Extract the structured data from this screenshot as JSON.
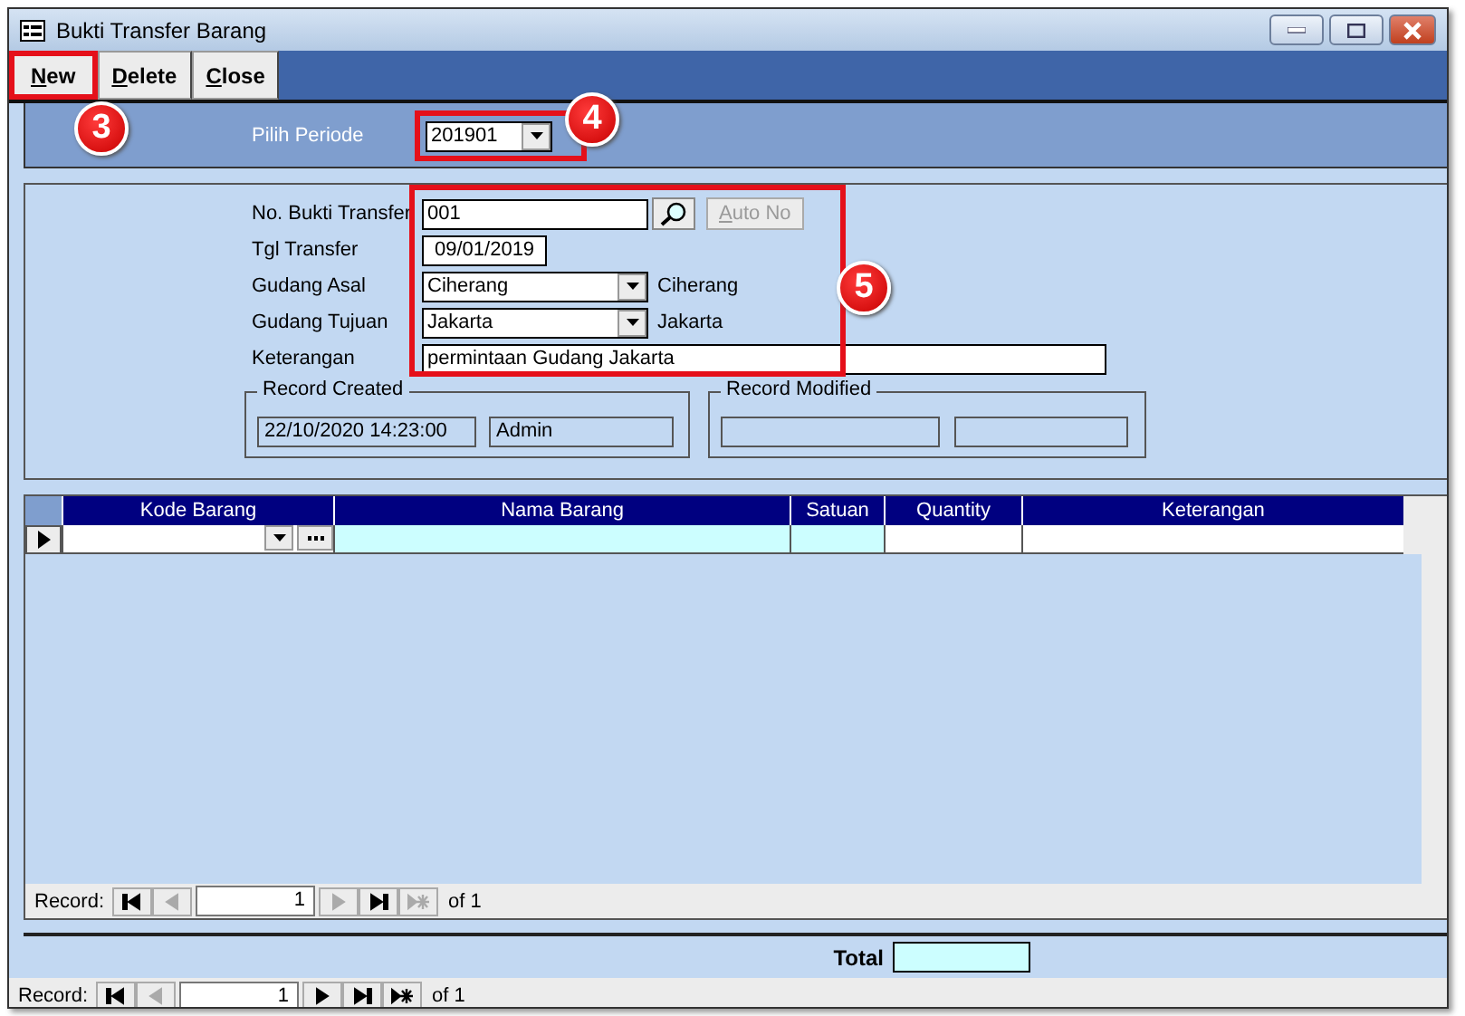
{
  "window": {
    "title": "Bukti Transfer Barang"
  },
  "toolbar": {
    "buttons": [
      {
        "label": "New",
        "highlighted": true
      },
      {
        "label": "Delete",
        "highlighted": false
      },
      {
        "label": "Close",
        "highlighted": false
      }
    ],
    "callout": "3"
  },
  "period": {
    "label": "Pilih Periode",
    "value": "201901",
    "callout": "4"
  },
  "form": {
    "callout": "5",
    "fields": [
      {
        "label": "No. Bukti Transfer",
        "kind": "lookup",
        "value": "001",
        "button": {
          "label": "Auto No",
          "disabled": true
        }
      },
      {
        "label": "Tgl Transfer",
        "kind": "date",
        "value": "09/01/2019"
      },
      {
        "label": "Gudang Asal",
        "kind": "combo",
        "value": "Ciherang",
        "caption": "Ciherang"
      },
      {
        "label": "Gudang Tujuan",
        "kind": "combo",
        "value": "Jakarta",
        "caption": "Jakarta"
      },
      {
        "label": "Keterangan",
        "kind": "text",
        "value": "permintaan Gudang Jakarta"
      }
    ],
    "groups": [
      {
        "title": "Record Created",
        "values": [
          "22/10/2020 14:23:00",
          "Admin"
        ]
      },
      {
        "title": "Record Modified"
      }
    ]
  },
  "grid": {
    "columns": [
      {
        "label": "Kode Barang",
        "kind": "combo",
        "readonly": false
      },
      {
        "label": "Nama Barang",
        "kind": "text",
        "readonly": true
      },
      {
        "label": "Satuan",
        "kind": "text",
        "readonly": true
      },
      {
        "label": "Quantity",
        "kind": "text",
        "readonly": false
      },
      {
        "label": "Keterangan",
        "kind": "text",
        "readonly": false
      }
    ],
    "navigator": {
      "label": "Record:",
      "current": "1",
      "total": "of 1",
      "buttons": [
        {
          "kind": "first",
          "disabled": false
        },
        {
          "kind": "prev",
          "disabled": true
        },
        {
          "kind": "next",
          "disabled": true
        },
        {
          "kind": "last",
          "disabled": false
        },
        {
          "kind": "new",
          "disabled": true
        }
      ]
    }
  },
  "footer": {
    "total_label": "Total"
  },
  "navigator": {
    "label": "Record:",
    "current": "1",
    "total": "of 1",
    "buttons": [
      {
        "kind": "first",
        "disabled": false
      },
      {
        "kind": "prev",
        "disabled": true
      },
      {
        "kind": "next",
        "disabled": false
      },
      {
        "kind": "last",
        "disabled": false
      },
      {
        "kind": "new",
        "disabled": false
      }
    ]
  }
}
